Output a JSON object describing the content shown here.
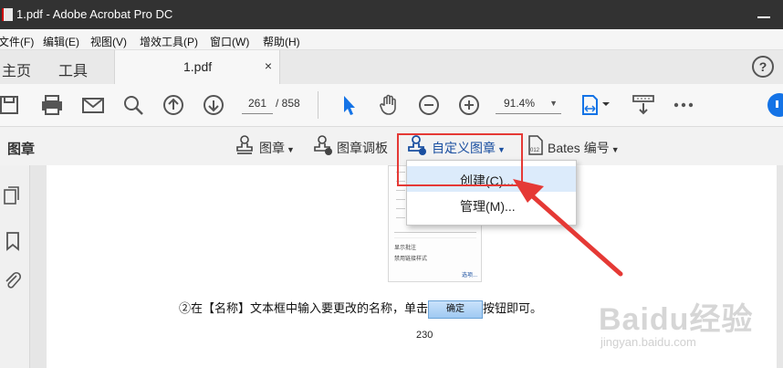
{
  "window": {
    "title": "1.pdf - Adobe Acrobat Pro DC"
  },
  "menu": [
    "文件(F)",
    "编辑(E)",
    "视图(V)",
    "增效工具(P)",
    "窗口(W)",
    "帮助(H)"
  ],
  "tabs": {
    "home": "主页",
    "tools": "工具",
    "doc": "1.pdf",
    "close": "×",
    "help": "?"
  },
  "toolbar": {
    "page_current": "261",
    "page_total": "/ 858",
    "zoom": "91.4%"
  },
  "stampbar": {
    "label": "图章",
    "stamp": "图章",
    "palette": "图章调板",
    "custom": "自定义图章",
    "bates": "Bates 编号"
  },
  "dropdown": {
    "create": "创建(C)...",
    "manage": "管理(M)..."
  },
  "document": {
    "text_before": "②在【名称】文本框中输入要更改的名称，单击",
    "ok_button": "确定",
    "text_after": "按钮即可。",
    "page_number": "230",
    "thumb_options": [
      "显示批注",
      "禁用链接样式"
    ],
    "thumb_link": "选项..."
  },
  "watermark": {
    "main": "Baidu经验",
    "sub": "jingyan.baidu.com"
  },
  "colors": {
    "accent": "#1473e6",
    "highlight": "#e53935",
    "titlebar": "#323232"
  }
}
